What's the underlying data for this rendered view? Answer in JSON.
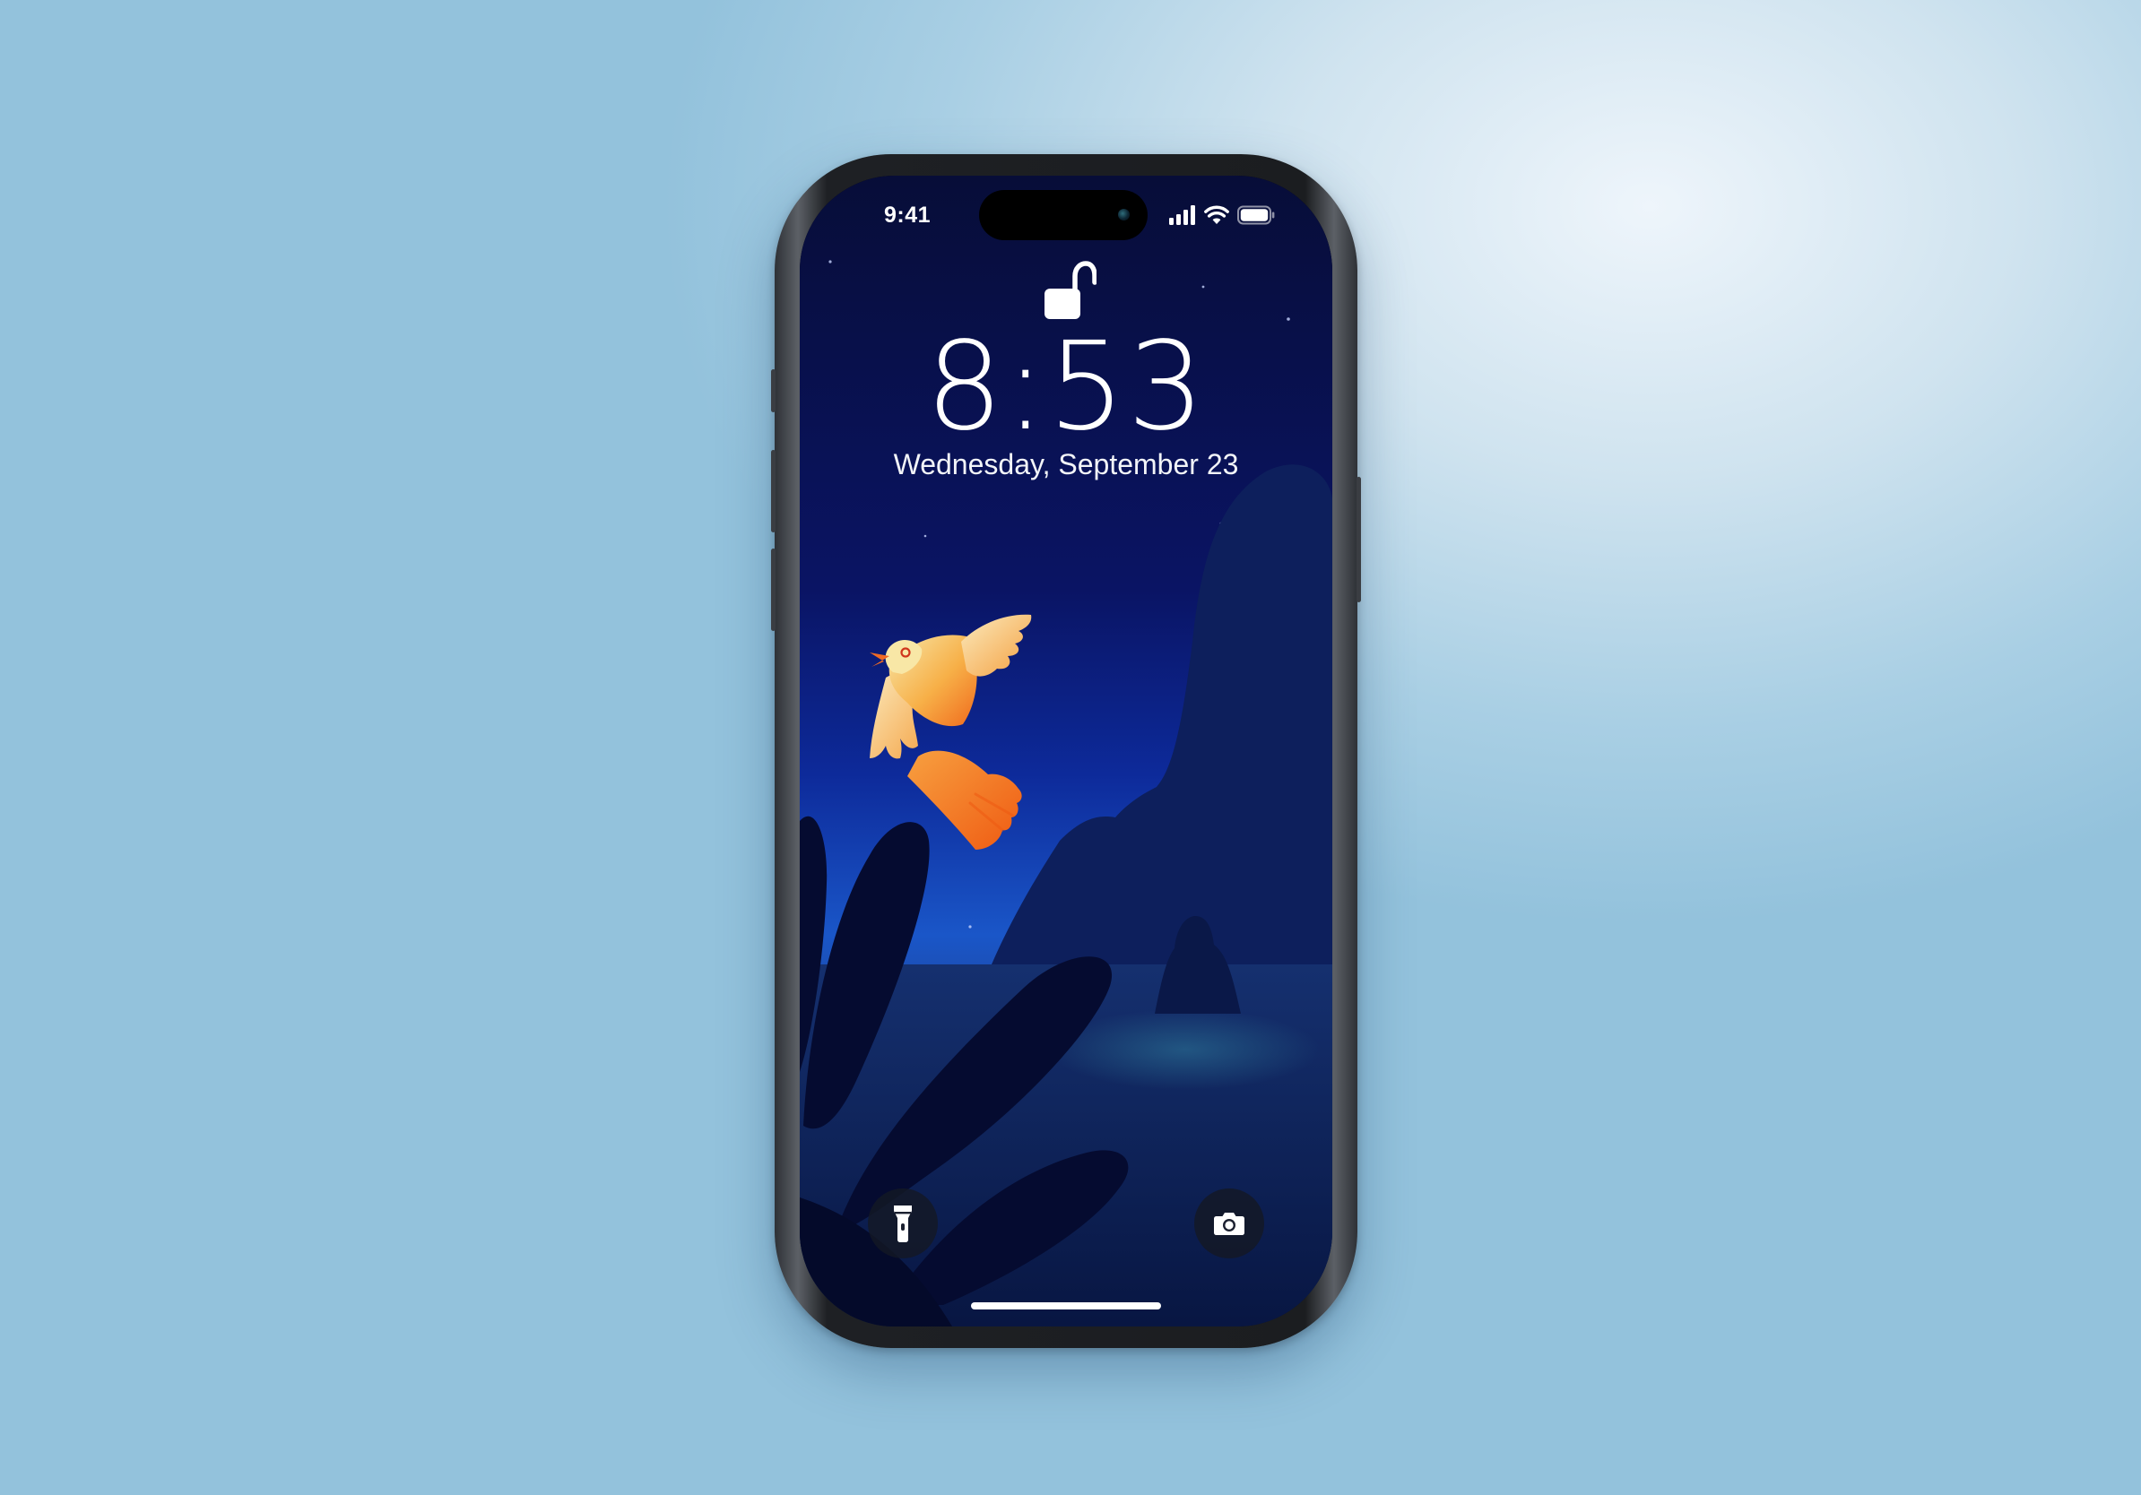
{
  "status_bar": {
    "time": "9:41",
    "icons": [
      "cellular-signal-icon",
      "wifi-icon",
      "battery-icon"
    ]
  },
  "lock_screen": {
    "lock_state_icon": "unlocked-padlock-icon",
    "time": "8:53",
    "date": "Wednesday, September 23"
  },
  "quick_actions": {
    "left": "flashlight-icon",
    "right": "camera-icon"
  },
  "colors": {
    "background": "#a9cfe4",
    "sky_top": "#070d38",
    "sky_horizon": "#1a56c8",
    "bird": "#f7b048",
    "frame": "#1b1d20"
  }
}
